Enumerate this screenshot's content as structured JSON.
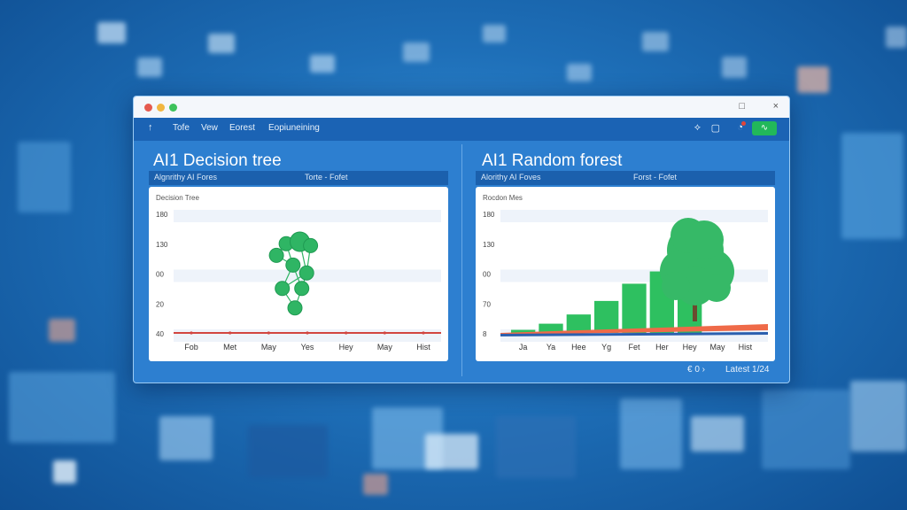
{
  "toolbar": {
    "items": [
      "Tofe",
      "Vew",
      "Eorest",
      "Eopiuneining"
    ],
    "back_icon": "arrow-up-icon"
  },
  "window_controls": {
    "restore": "□",
    "close": "×"
  },
  "status": {
    "green_button_label": "∿"
  },
  "left_panel": {
    "title": "AI1  Decision tree",
    "subheader": {
      "left": "Algnrithy  AI Fores",
      "right": "Torte - Fofet"
    },
    "chart_data": {
      "type": "line",
      "title": "Decision Tree",
      "categories": [
        "Fob",
        "Met",
        "May",
        "Yes",
        "Hey",
        "May",
        "Hist"
      ],
      "y_ticks": [
        "180",
        "130",
        "00",
        "20",
        "40"
      ],
      "series": [
        {
          "values": [
            0,
            0,
            0,
            0,
            0,
            0,
            0
          ],
          "color": "#d2453f"
        }
      ],
      "ylim": [
        0,
        180
      ],
      "grid": true,
      "tree_nodes": [
        {
          "x": 0.5,
          "y": 0.88
        },
        {
          "x": 0.37,
          "y": 0.68
        },
        {
          "x": 0.57,
          "y": 0.68
        },
        {
          "x": 0.62,
          "y": 0.52
        },
        {
          "x": 0.48,
          "y": 0.44
        },
        {
          "x": 0.31,
          "y": 0.34
        },
        {
          "x": 0.41,
          "y": 0.22
        },
        {
          "x": 0.55,
          "y": 0.2
        },
        {
          "x": 0.66,
          "y": 0.24
        }
      ],
      "tree_edges": [
        [
          0,
          1
        ],
        [
          0,
          2
        ],
        [
          1,
          3
        ],
        [
          2,
          3
        ],
        [
          1,
          4
        ],
        [
          2,
          4
        ],
        [
          4,
          5
        ],
        [
          4,
          6
        ],
        [
          3,
          7
        ],
        [
          3,
          8
        ],
        [
          6,
          7
        ],
        [
          5,
          6
        ]
      ],
      "node_color": "#2fb564"
    }
  },
  "right_panel": {
    "title": "AI1   Random forest",
    "subheader": {
      "left": "Alorithy  AI Foves",
      "right": "Forst - Fofet"
    },
    "chart_data": {
      "type": "bar",
      "title": "Rocdon Mes",
      "categories": [
        "Ja",
        "Ya",
        "Hee",
        "Yg",
        "Fet",
        "Her",
        "Hey",
        "May",
        "Hist"
      ],
      "y_ticks": [
        "180",
        "130",
        "00",
        "70",
        "8"
      ],
      "values": [
        5,
        15,
        30,
        52,
        80,
        100,
        132,
        0,
        0
      ],
      "ylim": [
        0,
        180
      ],
      "bar_color": "#2ec060",
      "band_color": "#ef6a48",
      "band2_color": "#2b5fae",
      "tree_icon": "tree-icon",
      "grid": true
    }
  },
  "footer": {
    "page_info": "€ 0  ›",
    "status": "Latest 1/24"
  }
}
